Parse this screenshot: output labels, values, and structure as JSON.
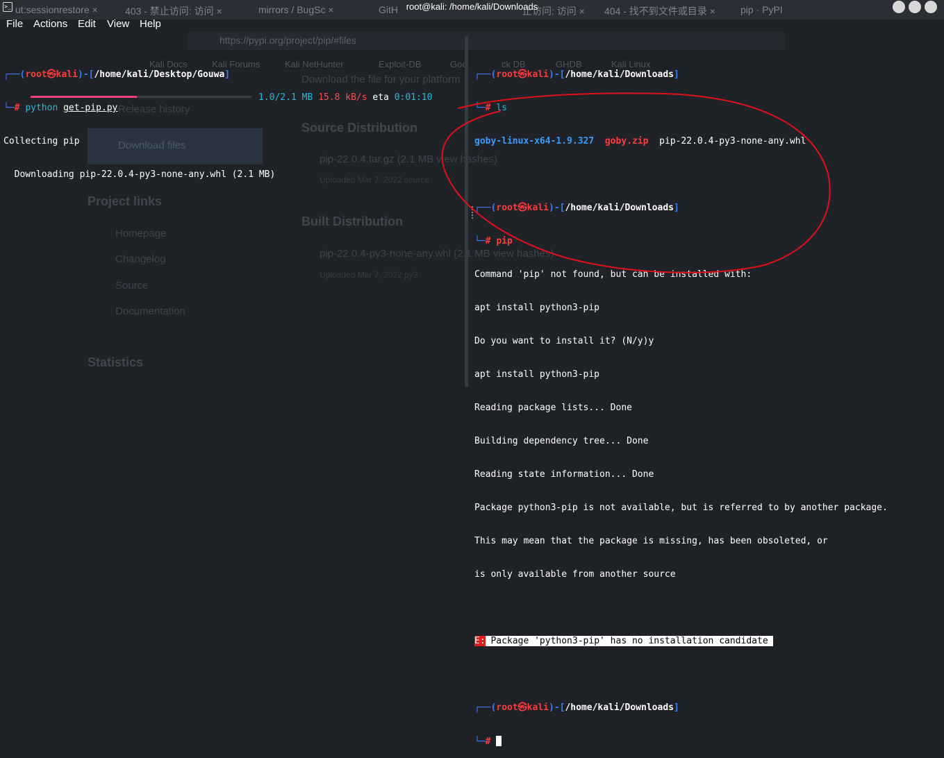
{
  "window": {
    "title": "root@kali: /home/kali/Downloads"
  },
  "menu": [
    "File",
    "Actions",
    "Edit",
    "View",
    "Help"
  ],
  "background_browser": {
    "tabs": [
      "ut:sessionrestore ×",
      "403 - 禁止访问: 访问 ×",
      "mirrors / BugSc ×",
      "GitH",
      "止访问: 访问 ×",
      "404 - 找不到文件或目录 ×",
      "pip · PyPI"
    ],
    "url": "https://pypi.org/project/pip/#files",
    "bookmarks": [
      "Kali Docs",
      "Kali Forums",
      "Kali NetHunter",
      "Exploit-DB",
      "Goo",
      "ck DB",
      "GHDB",
      "Kali Linux"
    ],
    "page": {
      "intro": "Download the file for your platform",
      "release_history": "Release history",
      "download_files": "Download files",
      "source_distribution": "Source Distribution",
      "sdist_file": "pip-22.0.4.tar.gz (2.1 MB view hashes)",
      "sdist_uploaded": "Uploaded Mar 7, 2022 source",
      "project_links": "Project links",
      "homepage": "Homepage",
      "changelog": "Changelog",
      "source": "Source",
      "documentation": "Documentation",
      "built_distribution": "Built Distribution",
      "wheel_file": "pip-22.0.4-py3-none-any.whl (2.1 MB view hashes)",
      "wheel_uploaded": "Uploaded Mar 7, 2022 py3",
      "statistics": "Statistics"
    }
  },
  "left_pane": {
    "prompt_path": "/home/kali/Desktop/Gouwa",
    "cmd_program": "python",
    "cmd_arg": "get-pip.py",
    "line_collecting": "Collecting pip",
    "line_downloading": "  Downloading pip-22.0.4-py3-none-any.whl (2.1 MB)",
    "progress_fraction": 0.48,
    "progress_size": "1.0/2.1 MB",
    "progress_speed": "15.8 kB/s",
    "progress_eta_label": "eta",
    "progress_eta": "0:01:10"
  },
  "prompt": {
    "user": "root",
    "skull": "㉿",
    "host": "kali",
    "symbol": "#"
  },
  "right_pane": {
    "path": "/home/kali/Downloads",
    "cmd1": "ls",
    "ls_files": [
      "goby-linux-x64-1.9.327",
      "goby.zip",
      "pip-22.0.4-py3-none-any.whl"
    ],
    "cmd2": "pip",
    "output": [
      "Command 'pip' not found, but can be installed with:",
      "apt install python3-pip",
      "Do you want to install it? (N/y)y",
      "apt install python3-pip",
      "Reading package lists... Done",
      "Building dependency tree... Done",
      "Reading state information... Done",
      "Package python3-pip is not available, but is referred to by another package.",
      "This may mean that the package is missing, has been obsoleted, or",
      "is only available from another source"
    ],
    "error_code": "E:",
    "error_message": " Package 'python3-pip' has no installation candidate "
  },
  "colors": {
    "background": "#1e2227",
    "prompt_frame": "#3a7bff",
    "prompt_user": "#ff3b3b",
    "progress": "#f0407a",
    "annotation": "#e0101a"
  }
}
